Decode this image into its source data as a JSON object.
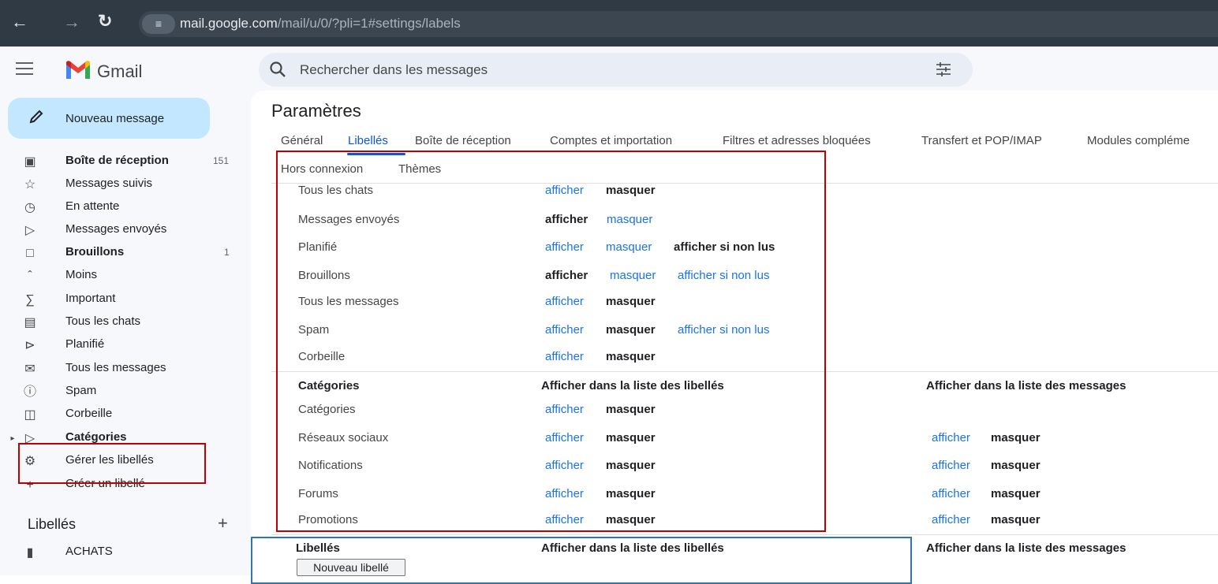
{
  "browser": {
    "url_host": "mail.google.com",
    "url_path": "/mail/u/0/?pli=1#settings/labels"
  },
  "app": {
    "name": "Gmail",
    "search_placeholder": "Rechercher dans les messages",
    "compose_label": "Nouveau message"
  },
  "sidebar": {
    "items": [
      {
        "label": "Boîte de réception",
        "count": "151",
        "icon": "inbox-icon",
        "bold": true
      },
      {
        "label": "Messages suivis",
        "count": "",
        "icon": "star-icon",
        "bold": false
      },
      {
        "label": "En attente",
        "count": "",
        "icon": "clock-icon",
        "bold": false
      },
      {
        "label": "Messages envoyés",
        "count": "",
        "icon": "send-icon",
        "bold": false
      },
      {
        "label": "Brouillons",
        "count": "1",
        "icon": "draft-icon",
        "bold": true
      },
      {
        "label": "Moins",
        "count": "",
        "icon": "chevron-up-icon",
        "bold": false
      },
      {
        "label": "Important",
        "count": "",
        "icon": "important-icon",
        "bold": false
      },
      {
        "label": "Tous les chats",
        "count": "",
        "icon": "chat-icon",
        "bold": false
      },
      {
        "label": "Planifié",
        "count": "",
        "icon": "scheduled-icon",
        "bold": false
      },
      {
        "label": "Tous les messages",
        "count": "",
        "icon": "all-mail-icon",
        "bold": false
      },
      {
        "label": "Spam",
        "count": "",
        "icon": "spam-icon",
        "bold": false
      },
      {
        "label": "Corbeille",
        "count": "",
        "icon": "trash-icon",
        "bold": false
      },
      {
        "label": "Catégories",
        "count": "",
        "icon": "label-icon",
        "bold": true
      },
      {
        "label": "Gérer les libellés",
        "count": "",
        "icon": "gear-icon",
        "bold": false
      },
      {
        "label": "Créer un libellé",
        "count": "",
        "icon": "plus-icon",
        "bold": false
      }
    ],
    "labels_title": "Libellés",
    "labels_add": "+",
    "user_labels": [
      {
        "label": "ACHATS",
        "icon": "label-icon"
      }
    ]
  },
  "settings": {
    "title": "Paramètres",
    "tabs": [
      "Général",
      "Libellés",
      "Boîte de réception",
      "Comptes et importation",
      "Filtres et adresses bloquées",
      "Transfert et POP/IMAP",
      "Modules compléme"
    ],
    "tabs_row2": [
      "Hors connexion",
      "Thèmes"
    ],
    "system_rows": [
      {
        "name": "Tous les chats",
        "a1": "afficher",
        "a2": "masquer",
        "a3": ""
      },
      {
        "name": "Messages envoyés",
        "a1": "afficher",
        "a2": "masquer",
        "a3": ""
      },
      {
        "name": "Planifié",
        "a1": "afficher",
        "a2": "masquer",
        "a3": "afficher si non lus"
      },
      {
        "name": "Brouillons",
        "a1": "afficher",
        "a2": "masquer",
        "a3": "afficher si non lus"
      },
      {
        "name": "Tous les messages",
        "a1": "afficher",
        "a2": "masquer",
        "a3": ""
      },
      {
        "name": "Spam",
        "a1": "afficher",
        "a2": "masquer",
        "a3": "afficher si non lus"
      },
      {
        "name": "Corbeille",
        "a1": "afficher",
        "a2": "masquer",
        "a3": ""
      }
    ],
    "categories_header": {
      "c1": "Catégories",
      "c2": "Afficher dans la liste des libellés",
      "c3": "Afficher dans la liste des messages"
    },
    "category_rows": [
      {
        "name": "Catégories",
        "a1": "afficher",
        "a2": "masquer",
        "m1": "",
        "m2": ""
      },
      {
        "name": "Réseaux sociaux",
        "a1": "afficher",
        "a2": "masquer",
        "m1": "afficher",
        "m2": "masquer"
      },
      {
        "name": "Notifications",
        "a1": "afficher",
        "a2": "masquer",
        "m1": "afficher",
        "m2": "masquer"
      },
      {
        "name": "Forums",
        "a1": "afficher",
        "a2": "masquer",
        "m1": "afficher",
        "m2": "masquer"
      },
      {
        "name": "Promotions",
        "a1": "afficher",
        "a2": "masquer",
        "m1": "afficher",
        "m2": "masquer"
      }
    ],
    "labels_header": {
      "c1": "Libellés",
      "c2": "Afficher dans la liste des libellés",
      "c3": "Afficher dans la liste des messages"
    },
    "new_label_button": "Nouveau libellé"
  },
  "colors": {
    "link": "#1a73e8",
    "annotation_red": "#c00000",
    "annotation_blue": "#2e75b6"
  }
}
